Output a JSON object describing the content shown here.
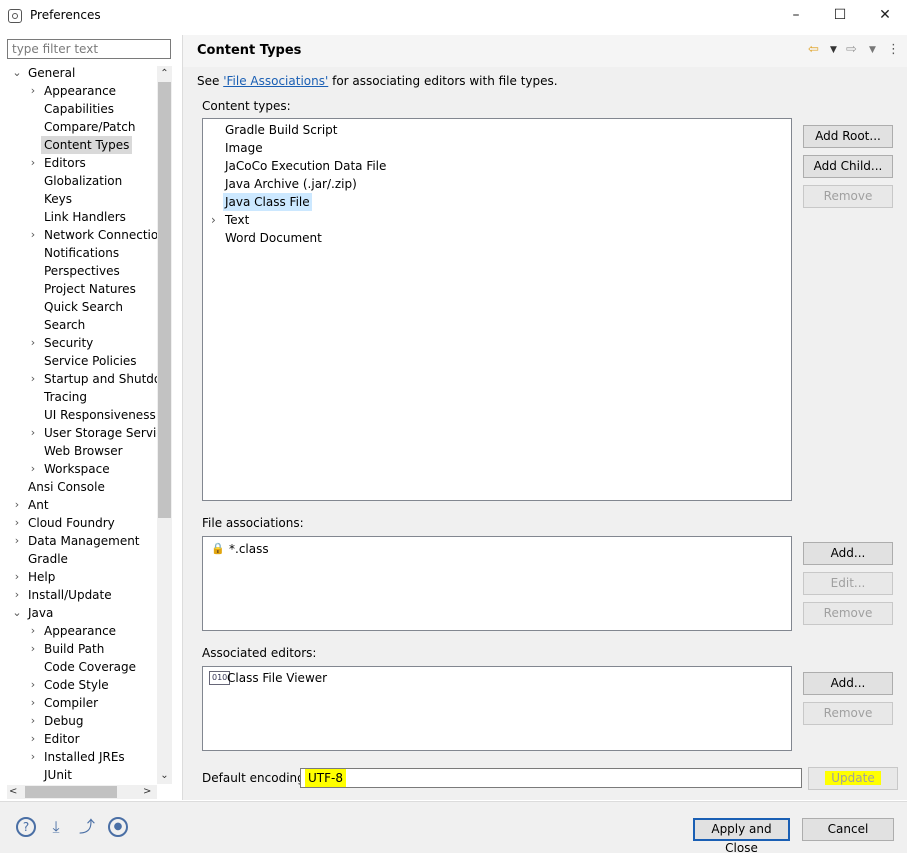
{
  "window": {
    "title": "Preferences",
    "min_glyph": "–",
    "max_glyph": "☐",
    "close_glyph": "✕"
  },
  "filter": {
    "placeholder": "type filter text"
  },
  "tree": [
    {
      "label": "General",
      "level": 0,
      "chev": "open"
    },
    {
      "label": "Appearance",
      "level": 1,
      "chev": "closed"
    },
    {
      "label": "Capabilities",
      "level": 1,
      "chev": ""
    },
    {
      "label": "Compare/Patch",
      "level": 1,
      "chev": ""
    },
    {
      "label": "Content Types",
      "level": 1,
      "chev": "",
      "selected": true
    },
    {
      "label": "Editors",
      "level": 1,
      "chev": "closed"
    },
    {
      "label": "Globalization",
      "level": 1,
      "chev": ""
    },
    {
      "label": "Keys",
      "level": 1,
      "chev": ""
    },
    {
      "label": "Link Handlers",
      "level": 1,
      "chev": ""
    },
    {
      "label": "Network Connection",
      "level": 1,
      "chev": "closed"
    },
    {
      "label": "Notifications",
      "level": 1,
      "chev": ""
    },
    {
      "label": "Perspectives",
      "level": 1,
      "chev": ""
    },
    {
      "label": "Project Natures",
      "level": 1,
      "chev": ""
    },
    {
      "label": "Quick Search",
      "level": 1,
      "chev": ""
    },
    {
      "label": "Search",
      "level": 1,
      "chev": ""
    },
    {
      "label": "Security",
      "level": 1,
      "chev": "closed"
    },
    {
      "label": "Service Policies",
      "level": 1,
      "chev": ""
    },
    {
      "label": "Startup and Shutdow",
      "level": 1,
      "chev": "closed"
    },
    {
      "label": "Tracing",
      "level": 1,
      "chev": ""
    },
    {
      "label": "UI Responsiveness M",
      "level": 1,
      "chev": ""
    },
    {
      "label": "User Storage Service",
      "level": 1,
      "chev": "closed"
    },
    {
      "label": "Web Browser",
      "level": 1,
      "chev": ""
    },
    {
      "label": "Workspace",
      "level": 1,
      "chev": "closed"
    },
    {
      "label": "Ansi Console",
      "level": 0,
      "chev": ""
    },
    {
      "label": "Ant",
      "level": 0,
      "chev": "closed"
    },
    {
      "label": "Cloud Foundry",
      "level": 0,
      "chev": "closed"
    },
    {
      "label": "Data Management",
      "level": 0,
      "chev": "closed"
    },
    {
      "label": "Gradle",
      "level": 0,
      "chev": ""
    },
    {
      "label": "Help",
      "level": 0,
      "chev": "closed"
    },
    {
      "label": "Install/Update",
      "level": 0,
      "chev": "closed"
    },
    {
      "label": "Java",
      "level": 0,
      "chev": "open"
    },
    {
      "label": "Appearance",
      "level": 1,
      "chev": "closed"
    },
    {
      "label": "Build Path",
      "level": 1,
      "chev": "closed"
    },
    {
      "label": "Code Coverage",
      "level": 1,
      "chev": ""
    },
    {
      "label": "Code Style",
      "level": 1,
      "chev": "closed"
    },
    {
      "label": "Compiler",
      "level": 1,
      "chev": "closed"
    },
    {
      "label": "Debug",
      "level": 1,
      "chev": "closed"
    },
    {
      "label": "Editor",
      "level": 1,
      "chev": "closed"
    },
    {
      "label": "Installed JREs",
      "level": 1,
      "chev": "closed"
    },
    {
      "label": "JUnit",
      "level": 1,
      "chev": ""
    }
  ],
  "page": {
    "title": "Content Types",
    "see_prefix": "See ",
    "see_link": "'File Associations'",
    "see_suffix": " for associating editors with file types.",
    "content_types_label": "Content types:",
    "content_types": [
      {
        "label": "Gradle Build Script",
        "chev": false
      },
      {
        "label": "Image",
        "chev": false
      },
      {
        "label": "JaCoCo Execution Data File",
        "chev": false
      },
      {
        "label": "Java Archive (.jar/.zip)",
        "chev": false
      },
      {
        "label": "Java Class File",
        "chev": false,
        "selected": true
      },
      {
        "label": "Text",
        "chev": true
      },
      {
        "label": "Word Document",
        "chev": false
      }
    ],
    "add_root": "Add Root...",
    "add_child": "Add Child...",
    "remove": "Remove",
    "file_assoc_label": "File associations:",
    "file_assoc": [
      "*.class"
    ],
    "add": "Add...",
    "edit": "Edit...",
    "assoc_editors_label": "Associated editors:",
    "assoc_editors": [
      "Class File Viewer"
    ],
    "encoding_label": "Default encoding:",
    "encoding_value": "UTF-8",
    "update": "Update"
  },
  "footer": {
    "apply_close": "Apply and Close",
    "cancel": "Cancel"
  }
}
